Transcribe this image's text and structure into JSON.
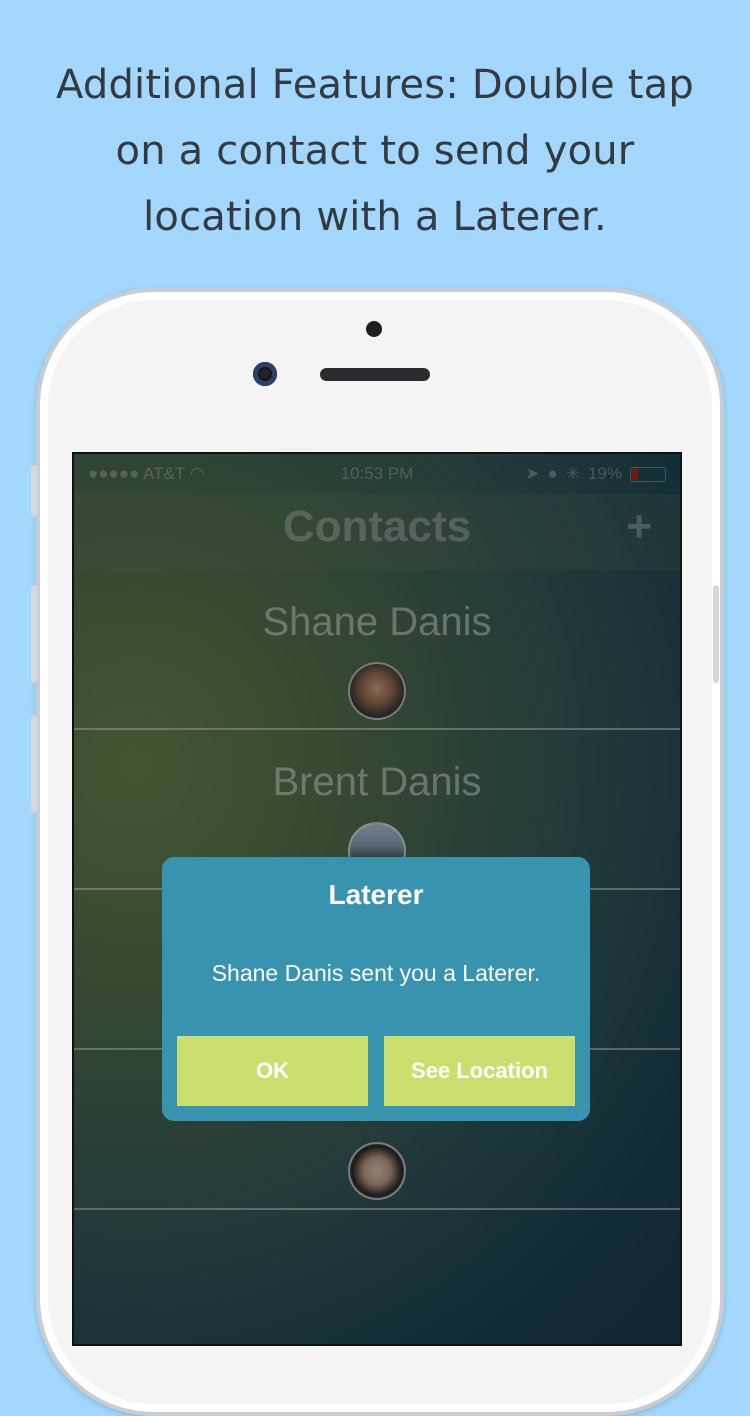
{
  "headline": {
    "line1": "Additional Features: Double tap",
    "line2": "on a contact to send your",
    "line3": "location with a Laterer."
  },
  "status_bar": {
    "carrier": "●●●●● AT&T",
    "time": "10:53 PM",
    "battery": "19%"
  },
  "nav": {
    "title": "Contacts",
    "add_label": "+"
  },
  "contacts": [
    {
      "name": "Shane Danis"
    },
    {
      "name": "Brent Danis"
    },
    {
      "name": ""
    },
    {
      "name": ""
    }
  ],
  "alert": {
    "title": "Laterer",
    "message": "Shane Danis sent you a Laterer.",
    "ok_label": "OK",
    "location_label": "See Location"
  },
  "colors": {
    "background": "#a3d7fd",
    "alert": "#3893af",
    "alert_button": "#cbdf6e"
  }
}
